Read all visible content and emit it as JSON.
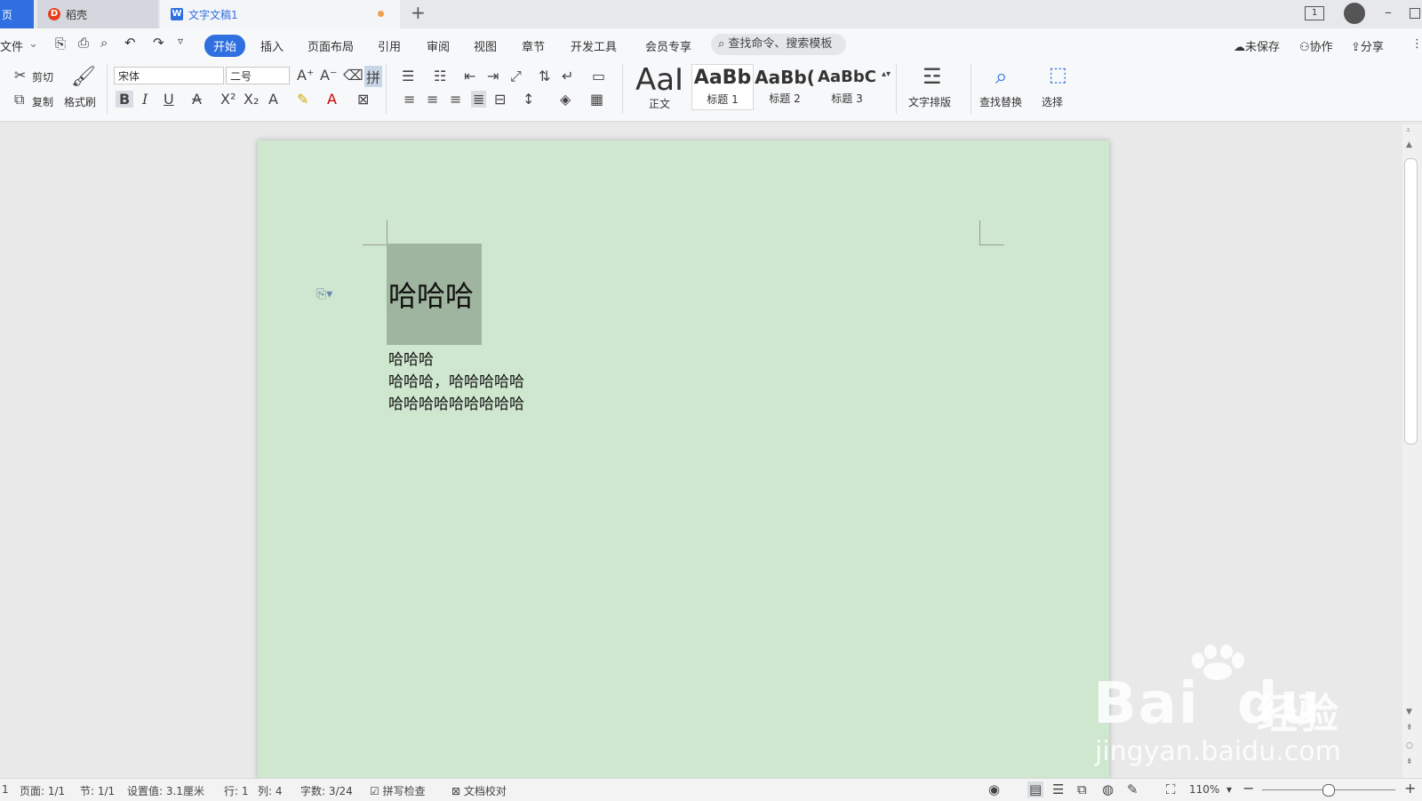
{
  "tabs": {
    "home": "页",
    "daoke": "稻壳",
    "doc": "文字文稿1",
    "add": "+"
  },
  "menu": {
    "file": "文件",
    "start": "开始",
    "insert": "插入",
    "layout": "页面布局",
    "references": "引用",
    "review": "审阅",
    "view": "视图",
    "chapter": "章节",
    "devtools": "开发工具",
    "vip": "会员专享",
    "search_placeholder": "查找命令、搜索模板",
    "unsaved": "未保存",
    "collab": "协作",
    "share": "分享"
  },
  "ribbon": {
    "cut": "剪切",
    "copy": "复制",
    "format_painter": "格式刷",
    "font_name": "宋体",
    "font_size": "二号",
    "styles": [
      {
        "preview": "AaI",
        "label": "正文"
      },
      {
        "preview": "AaBb",
        "label": "标题 1"
      },
      {
        "preview": "AaBb(",
        "label": "标题 2"
      },
      {
        "preview": "AaBbC",
        "label": "标题 3"
      }
    ],
    "text_layout": "文字排版",
    "find_replace": "查找替换",
    "select": "选择"
  },
  "document": {
    "heading": "哈哈哈",
    "lines": [
      "哈哈哈",
      "哈哈哈，哈哈哈哈哈",
      "哈哈哈哈哈哈哈哈哈"
    ]
  },
  "status": {
    "page_num": "1",
    "page": "页面: 1/1",
    "section": "节: 1/1",
    "setting": "设置值: 3.1厘米",
    "row": "行: 1",
    "col": "列: 4",
    "words": "字数: 3/24",
    "spell": "拼写检查",
    "proof": "文档校对",
    "zoom": "110%"
  },
  "watermark": {
    "logo": "Bai",
    "logo_tail": "du",
    "product": "经验",
    "url": "jingyan.baidu.com"
  },
  "colors": {
    "accent": "#2f6fe0",
    "page_bg": "#cfe6cf",
    "selection": "#9fb59f"
  }
}
